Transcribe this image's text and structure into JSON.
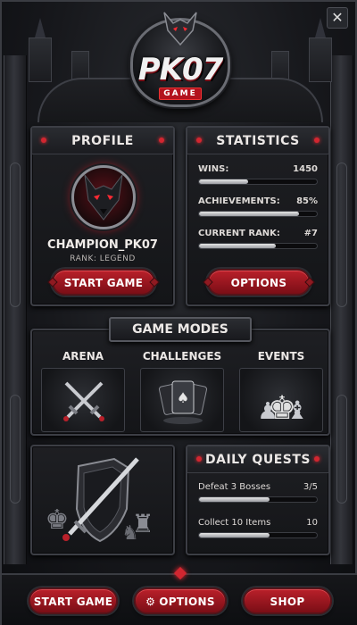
{
  "header": {
    "logo_title": "PK07",
    "logo_subtitle": "GAME",
    "close_label": "✕"
  },
  "profile": {
    "title": "PROFILE",
    "player_name": "CHAMPION_PK07",
    "rank_text": "RANK: LEGEND",
    "start_label": "START GAME"
  },
  "statistics": {
    "title": "STATISTICS",
    "items": [
      {
        "label": "WINS:",
        "value": "1450",
        "fill": 0.42
      },
      {
        "label": "ACHIEVEMENTS:",
        "value": "85%",
        "fill": 0.85
      },
      {
        "label": "CURRENT RANK:",
        "value": "#7",
        "fill": 0.65
      }
    ],
    "options_label": "OPTIONS"
  },
  "game_modes": {
    "title": "GAME MODES",
    "modes": [
      {
        "label": "ARENA",
        "icon": "crossed-swords-icon"
      },
      {
        "label": "CHALLENGES",
        "icon": "playing-cards-icon"
      },
      {
        "label": "EVENTS",
        "icon": "chess-pieces-icon"
      }
    ]
  },
  "daily_quests": {
    "title": "DAILY QUESTS",
    "quests": [
      {
        "name": "Defeat 3 Bosses",
        "value": "3/5",
        "fill": 0.6
      },
      {
        "name": "Collect 10 Items",
        "value": "10",
        "fill": 0.6
      }
    ]
  },
  "bottom_nav": {
    "start_label": "START GAME",
    "options_label": "OPTIONS",
    "shop_label": "SHOP"
  },
  "colors": {
    "accent": "#b9202a",
    "glow": "#ff2a33",
    "panel": "#1e1f23"
  }
}
